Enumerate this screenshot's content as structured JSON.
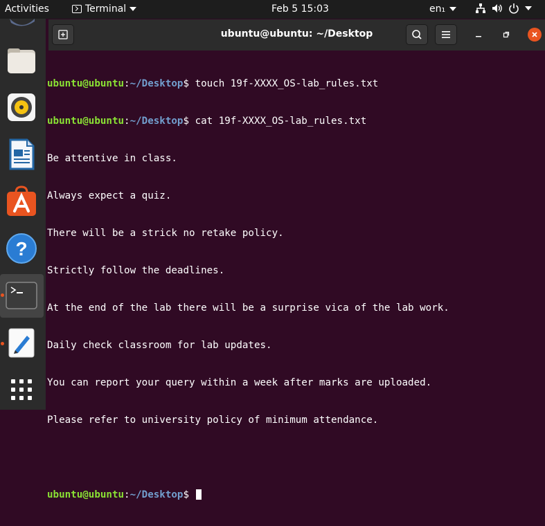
{
  "topbar": {
    "activities": "Activities",
    "app_name": "Terminal",
    "clock": "Feb 5  15:03",
    "lang": "en₁",
    "tray_icons": [
      "network-icon",
      "volume-icon",
      "power-icon",
      "chevron-down-icon"
    ]
  },
  "dock": {
    "items": [
      "files-icon",
      "rhythmbox-icon",
      "libreoffice-writer-icon",
      "ubuntu-software-icon",
      "help-icon",
      "terminal-icon",
      "text-editor-icon",
      "show-apps-icon"
    ]
  },
  "window": {
    "title": "ubuntu@ubuntu: ~/Desktop"
  },
  "terminal": {
    "user_host": "ubuntu@ubuntu",
    "colon": ":",
    "path": "~/Desktop",
    "dollar": "$ ",
    "commands": [
      "touch 19f-XXXX_OS-lab_rules.txt",
      "cat 19f-XXXX_OS-lab_rules.txt"
    ],
    "output": [
      "Be attentive in class.",
      "Always expect a quiz.",
      "There will be a strick no retake policy.",
      "Strictly follow the deadlines.",
      "At the end of the lab there will be a surprise vica of the lab work.",
      "Daily check classroom for lab updates.",
      "You can report your query within a week after marks are uploaded.",
      "Please refer to university policy of minimum attendance."
    ]
  },
  "colors": {
    "terminal_bg": "#300a24",
    "prompt_user": "#8ae234",
    "prompt_path": "#729fcf",
    "accent": "#e95420"
  }
}
